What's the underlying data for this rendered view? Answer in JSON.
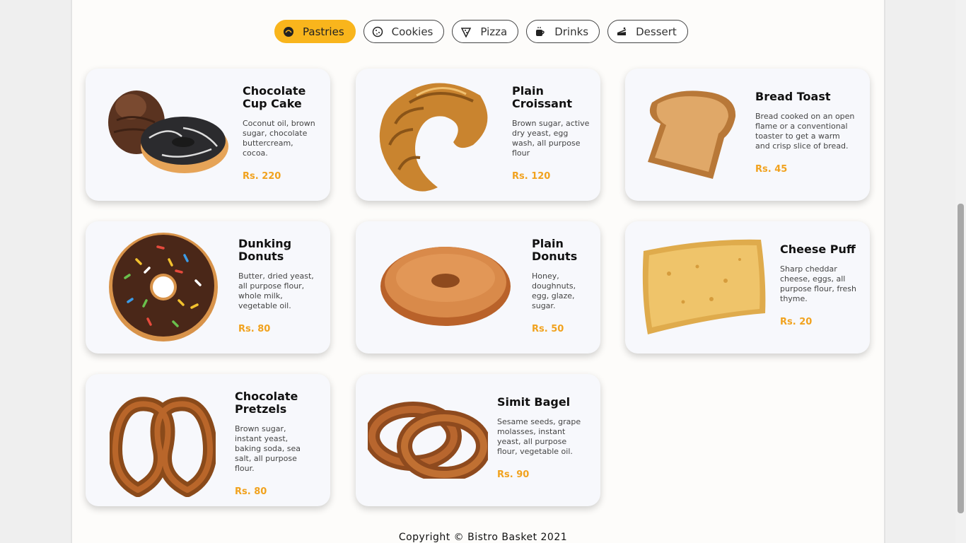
{
  "categories": [
    {
      "label": "Pastries",
      "icon": "croissant-icon",
      "active": true
    },
    {
      "label": "Cookies",
      "icon": "cookie-icon",
      "active": false
    },
    {
      "label": "Pizza",
      "icon": "pizza-slice-icon",
      "active": false
    },
    {
      "label": "Drinks",
      "icon": "coffee-cup-icon",
      "active": false
    },
    {
      "label": "Dessert",
      "icon": "cake-icon",
      "active": false
    }
  ],
  "items": [
    {
      "name": "Chocolate Cup Cake",
      "description": "Coconut oil, brown sugar, chocolate buttercream, cocoa.",
      "price": "Rs. 220"
    },
    {
      "name": "Plain Croissant",
      "description": "Brown sugar, active dry yeast, egg wash, all purpose flour",
      "price": "Rs. 120"
    },
    {
      "name": "Bread Toast",
      "description": "Bread cooked on an open flame or a conventional toaster to get a warm and crisp slice of bread.",
      "price": "Rs. 45"
    },
    {
      "name": "Dunking Donuts",
      "description": "Butter, dried yeast, all purpose flour, whole milk, vegetable oil.",
      "price": "Rs. 80"
    },
    {
      "name": "Plain Donuts",
      "description": "Honey, doughnuts, egg, glaze, sugar.",
      "price": "Rs. 50"
    },
    {
      "name": "Cheese Puff",
      "description": "Sharp cheddar cheese, eggs, all purpose flour, fresh thyme.",
      "price": "Rs. 20"
    },
    {
      "name": "Chocolate Pretzels",
      "description": "Brown sugar, instant yeast, baking soda, sea salt, all purpose flour.",
      "price": "Rs. 80"
    },
    {
      "name": "Simit Bagel",
      "description": "Sesame seeds, grape molasses, instant yeast, all purpose flour, vegetable oil.",
      "price": "Rs. 90"
    }
  ],
  "footer": {
    "copyright": "Copyright © Bistro Basket 2021"
  },
  "colors": {
    "accent": "#f9b51c",
    "price": "#f1a21e",
    "card": "#f7f8fc"
  }
}
